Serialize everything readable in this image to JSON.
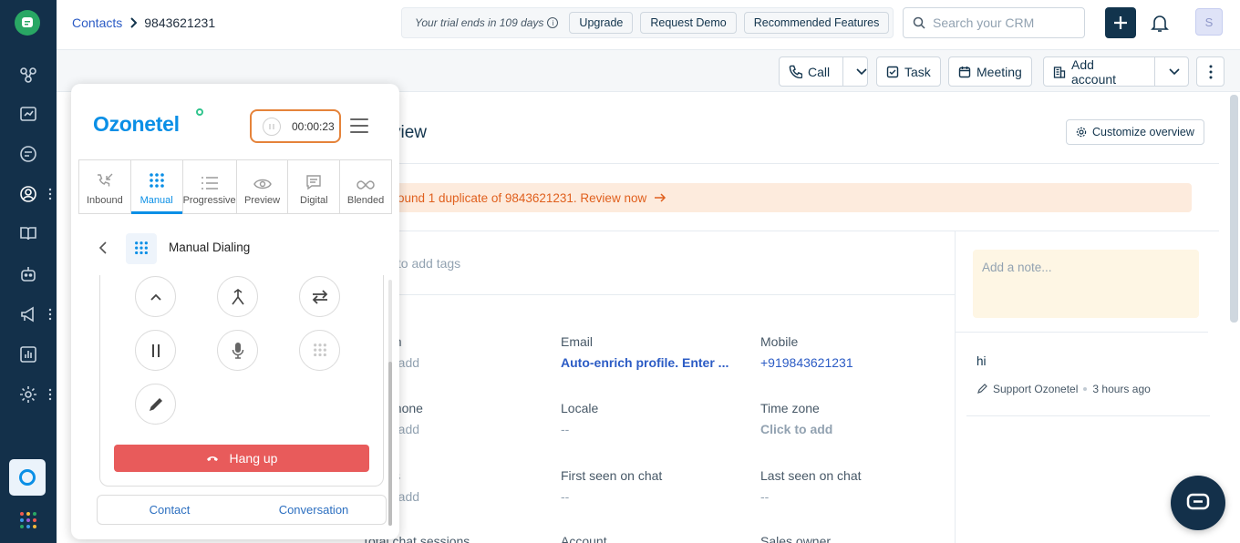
{
  "breadcrumb": {
    "parent": "Contacts",
    "current": "9843621231"
  },
  "trial": {
    "text": "Your trial ends in 109 days",
    "upgrade": "Upgrade",
    "request_demo": "Request Demo",
    "recommended": "Recommended Features"
  },
  "search": {
    "placeholder": "Search your CRM"
  },
  "user": {
    "initial": "S"
  },
  "actions": {
    "call": "Call",
    "task": "Task",
    "meeting": "Meeting",
    "add_account": "Add account"
  },
  "overview": {
    "title": "view",
    "customize": "Customize overview",
    "duplicate_notice": "ound 1 duplicate of 9843621231. Review now",
    "tags_hint": "k to add tags"
  },
  "fields": [
    {
      "label": "on",
      "value": "o add"
    },
    {
      "label": "Email",
      "value": "Auto-enrich profile. Enter ..."
    },
    {
      "label": "Mobile",
      "value": "+919843621231"
    },
    {
      "label": "phone",
      "value": "o add"
    },
    {
      "label": "Locale",
      "value": "--"
    },
    {
      "label": "Time zone",
      "value": "Click to add"
    },
    {
      "label": "ss",
      "value": "o add"
    },
    {
      "label": "First seen on chat",
      "value": "--"
    },
    {
      "label": "Last seen on chat",
      "value": "--"
    },
    {
      "label": "Total chat sessions",
      "value": ""
    },
    {
      "label": "Account",
      "value": ""
    },
    {
      "label": "Sales owner",
      "value": ""
    }
  ],
  "notes": {
    "placeholder": "Add a note...",
    "text": "hi",
    "author": "Support Ozonetel",
    "time": "3 hours ago"
  },
  "widget": {
    "brand": "Ozonetel",
    "timer": "00:00:23",
    "modes": [
      "Inbound",
      "Manual",
      "Progressive",
      "Preview",
      "Digital",
      "Blended"
    ],
    "section_title": "Manual Dialing",
    "hang_up": "Hang up",
    "tabs": [
      "Contact",
      "Conversation"
    ]
  },
  "colors": {
    "accent": "#2c5cc5",
    "rail": "#13304a",
    "hangup": "#e85b5b",
    "ozonetel": "#0a8fe6",
    "warning": "#e0601e"
  }
}
